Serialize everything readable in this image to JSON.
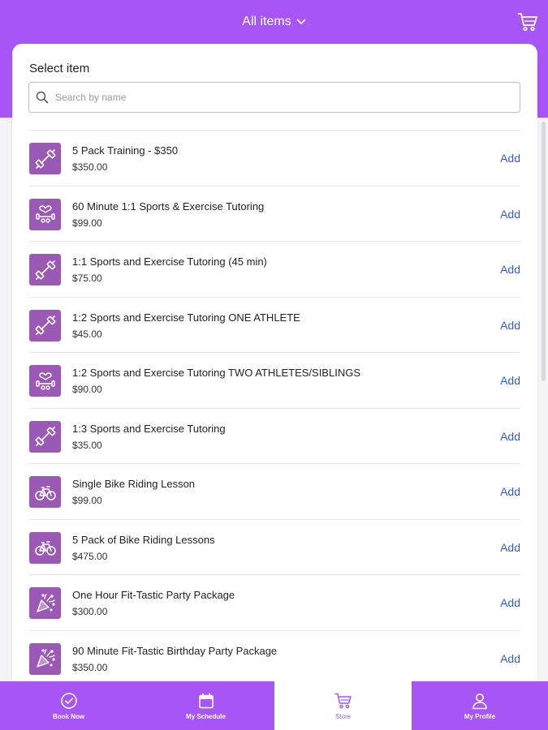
{
  "header": {
    "filter_label": "All items",
    "cart_icon": "cart-icon",
    "chevron_icon": "chevron-down-icon"
  },
  "colors": {
    "brand_purple": "#a855f7",
    "icon_tile": "#9b59b6",
    "link_blue": "#2d5be3"
  },
  "select": {
    "title": "Select item",
    "search_placeholder": "Search by name"
  },
  "items": [
    {
      "name": "5 Pack Training - $350",
      "price": "$350.00",
      "action": "Add",
      "icon": "dumbbell-icon"
    },
    {
      "name": "60 Minute 1:1 Sports & Exercise Tutoring",
      "price": "$99.00",
      "action": "Add",
      "icon": "fitness-heart-icon"
    },
    {
      "name": "1:1 Sports and Exercise Tutoring (45 min)",
      "price": "$75.00",
      "action": "Add",
      "icon": "dumbbell-icon"
    },
    {
      "name": "1:2 Sports and Exercise Tutoring ONE ATHLETE",
      "price": "$45.00",
      "action": "Add",
      "icon": "dumbbell-icon"
    },
    {
      "name": "1:2 Sports and Exercise Tutoring TWO ATHLETES/SIBLINGS",
      "price": "$90.00",
      "action": "Add",
      "icon": "fitness-heart-icon"
    },
    {
      "name": "1:3 Sports and Exercise Tutoring",
      "price": "$35.00",
      "action": "Add",
      "icon": "dumbbell-icon"
    },
    {
      "name": "Single Bike Riding Lesson",
      "price": "$99.00",
      "action": "Add",
      "icon": "bicycle-icon"
    },
    {
      "name": "5 Pack of Bike Riding Lessons",
      "price": "$475.00",
      "action": "Add",
      "icon": "bicycle-icon"
    },
    {
      "name": "One Hour Fit-Tastic Party Package",
      "price": "$300.00",
      "action": "Add",
      "icon": "party-popper-icon"
    },
    {
      "name": "90 Minute Fit-Tastic Birthday Party Package",
      "price": "$350.00",
      "action": "Add",
      "icon": "party-popper-icon"
    }
  ],
  "nav": {
    "book_now": "Book Now",
    "my_schedule": "My Schedule",
    "store": "Store",
    "my_profile": "My Profile",
    "active": "Store"
  }
}
